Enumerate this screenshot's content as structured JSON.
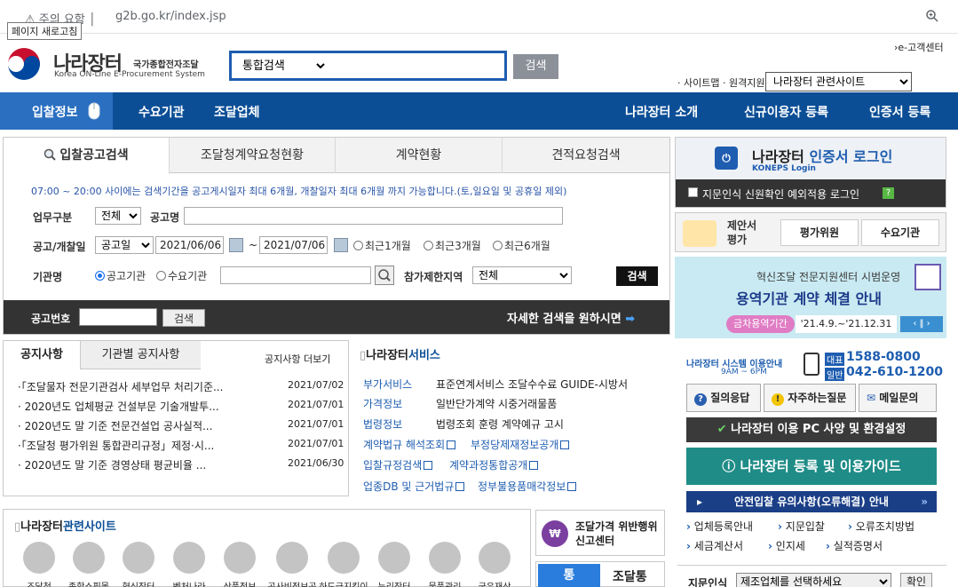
{
  "browser": {
    "security": "주의 요함",
    "url": "g2b.go.kr/index.jsp",
    "tooltip": "페이지 새로고침"
  },
  "header": {
    "logo_name": "나라장터",
    "logo_sub": "국가종합전자조달",
    "logo_en": "Korea ON-Line E-Procurement System",
    "search_select": "통합검색",
    "search_button": "검색",
    "customer_center": "›e-고객센터",
    "sitemap": "· 사이트맵 · 원격지원",
    "related_select": "나라장터 관련사이트"
  },
  "nav": {
    "items": [
      "입찰정보",
      "수요기관",
      "조달업체",
      "나라장터 소개",
      "신규이용자 등록",
      "인증서 등록"
    ]
  },
  "search_panel": {
    "tabs": [
      "입찰공고검색",
      "조달청계약요청현황",
      "계약현황",
      "견적요청검색"
    ],
    "notice": "07:00 ~ 20:00 사이에는 검색기간을 공고게시일자 최대 6개월, 개찰일자 최대 6개월 까지 가능합니다.(토,일요일 및 공휴일 제외)",
    "biz_type_label": "업무구분",
    "biz_type_value": "전체",
    "title_label": "공고명",
    "date_label": "공고/개찰일",
    "date_type": "공고일",
    "date_from": "2021/06/06",
    "date_sep": "~",
    "date_to": "2021/07/06",
    "ranges": [
      "최근1개월",
      "최근3개월",
      "최근6개월"
    ],
    "agency_label": "기관명",
    "agency_opts": [
      "공고기관",
      "수요기관"
    ],
    "region_label": "참가제한지역",
    "region_value": "전체",
    "search_button": "검색",
    "num_label": "공고번호",
    "num_button": "검색",
    "detail_link": "자세한 검색을 원하시면"
  },
  "notices": {
    "tabs": [
      "공지사항",
      "기관별 공지사항"
    ],
    "more": "공지사항 더보기",
    "rows": [
      {
        "title": "·「조달물자 전문기관검사 세부업무 처리기준...",
        "date": "2021/07/02"
      },
      {
        "title": "· 2020년도 업체평균 건설부문 기술개발투...",
        "date": "2021/07/01"
      },
      {
        "title": "· 2020년도 말 기준 전문건설업 공사실적...",
        "date": "2021/07/01"
      },
      {
        "title": "·「조달청 평가위원 통합관리규정」제정·시...",
        "date": "2021/07/01"
      },
      {
        "title": "· 2020년도 말 기준 경영상태 평균비율 ...",
        "date": "2021/06/30"
      }
    ]
  },
  "services": {
    "title_a": "나라장터",
    "title_b": "서비스",
    "rows": [
      {
        "k": "부가서비스",
        "v": "표준연계서비스 조달수수료 GUIDE-시방서"
      },
      {
        "k": "가격정보",
        "v": "일반단가계약 시중거래물품"
      },
      {
        "k": "법령정보",
        "v": "법령조회 훈령 계약예규 고시"
      }
    ],
    "links": [
      "계약법규 해석조회",
      "부정당제재정보공개",
      "입찰규정검색",
      "계약과정통합공개",
      "업종DB 및 근거법규",
      "정부불용품매각정보"
    ]
  },
  "related": {
    "title_a": "나라장터",
    "title_b": "관련사이트",
    "items": [
      "조달청",
      "종합쇼핑몰",
      "혁신장터",
      "벤처나라",
      "상품정보",
      "공사비정보공개",
      "하도급지킴이",
      "누리장터",
      "물품관리",
      "국유재산"
    ]
  },
  "report": {
    "line1": "조달가격 위반행위",
    "line2": "신고센터",
    "tong": "조달통"
  },
  "right": {
    "login_title_a": "나라장터 ",
    "login_title_b": "인증서 로그인",
    "login_sub": "KONEPS Login",
    "finger_login": "지문인식 신원확인 예외적용 로그인",
    "proposal": "제안서 평가",
    "eval_btn": "평가위원",
    "agency_btn": "수요기관",
    "banner_line1": "혁신조달 전문지원센터 시범운영",
    "banner_line2": "용역기관 계약 체결 안내",
    "banner_tag": "금차용역기간",
    "banner_period": "'21.4.9.~'21.12.31",
    "contact_title": "나라장터 시스템 이용안내",
    "contact_hours": "9AM ~ 6PM",
    "rep_label": "대표",
    "rep_num": "1588-0800",
    "gen_label": "일반",
    "gen_num": "042-610-1200",
    "q_btns": [
      "질의응답",
      "자주하는질문",
      "메일문의"
    ],
    "pc_spec": "나라장터 이용 PC 사양 및 환경설정",
    "guide": "나라장터 등록 및 이용가이드",
    "safe": "안전입찰 유의사항(오류해결) 안내",
    "links": [
      "업체등록안내",
      "지문입찰",
      "오류조치방법",
      "세금계산서",
      "인지세",
      "실적증명서"
    ],
    "finger_label": "지문인식",
    "finger_select": "제조업체를 선택하세요",
    "finger_btn": "확인"
  }
}
